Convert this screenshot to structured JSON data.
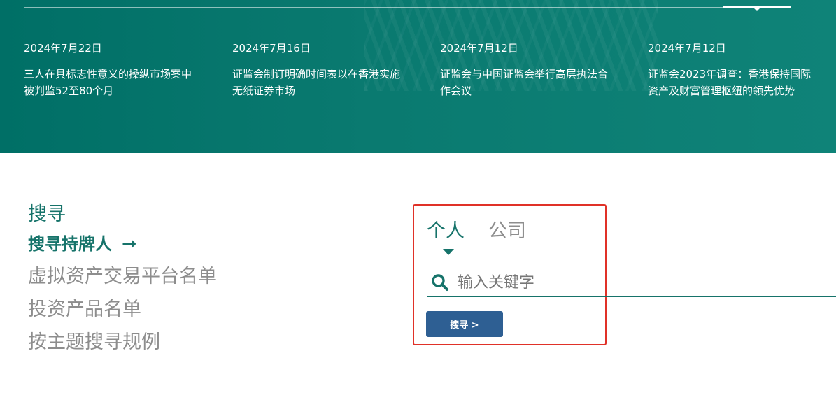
{
  "news": [
    {
      "date": "2024年7月22日",
      "title": "三人在具标志性意义的操纵市场案中被判监52至80个月"
    },
    {
      "date": "2024年7月16日",
      "title": "证监会制订明确时间表以在香港实施无纸证券市场"
    },
    {
      "date": "2024年7月12日",
      "title": "证监会与中国证监会举行高层执法合作会议"
    },
    {
      "date": "2024年7月12日",
      "title": "证监会2023年调查：香港保持国际资产及财富管理枢纽的领先优势"
    }
  ],
  "left_menu": {
    "heading": "搜寻",
    "active_item": "搜寻持牌人",
    "active_arrow": "➞",
    "items": [
      "虚拟资产交易平台名单",
      "投资产品名单",
      "按主题搜寻规例"
    ]
  },
  "search": {
    "tabs": [
      "个人",
      "公司"
    ],
    "placeholder": "输入关键字",
    "button_label": "搜寻 >"
  },
  "colors": {
    "brand_teal": "#16736a",
    "band_bg": "#0a7a70",
    "button_blue": "#2e5f93",
    "highlight_red": "#e03128"
  },
  "icons": {
    "search": "search-icon",
    "arrow": "arrow-right-icon"
  }
}
